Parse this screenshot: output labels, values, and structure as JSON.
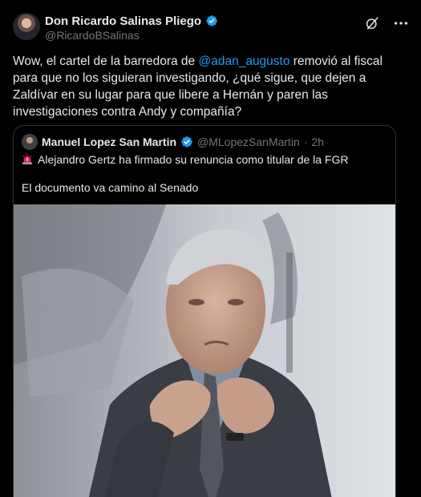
{
  "tweet": {
    "author_name": "Don Ricardo Salinas Pliego",
    "author_handle": "@RicardoBSalinas",
    "text_part1": "Wow, el cartel de la barredora de ",
    "mention": "@adan_augusto",
    "text_part2": " removió al fiscal para que no los siguieran investigando, ¿qué sigue, que dejen a Zaldívar en su lugar para que libere a Hernán y paren las investigaciones contra Andy y compañía?"
  },
  "quote": {
    "author_name": "Manuel Lopez San Martin",
    "author_handle": "@MLopezSanMartin",
    "separator": "·",
    "time": "2h",
    "line1": "Alejandro Gertz ha firmado su renuncia como titular de la FGR",
    "line2": "El documento va camino al Senado"
  },
  "icons": {
    "verified": "verified-badge-icon",
    "grok": "grok-icon",
    "more": "more-options-icon",
    "siren": "siren-emoji-icon"
  },
  "colors": {
    "background": "#000000",
    "text": "#e7e9ea",
    "secondary": "#71767b",
    "accent": "#1d9bf0",
    "border": "#2f3336"
  }
}
